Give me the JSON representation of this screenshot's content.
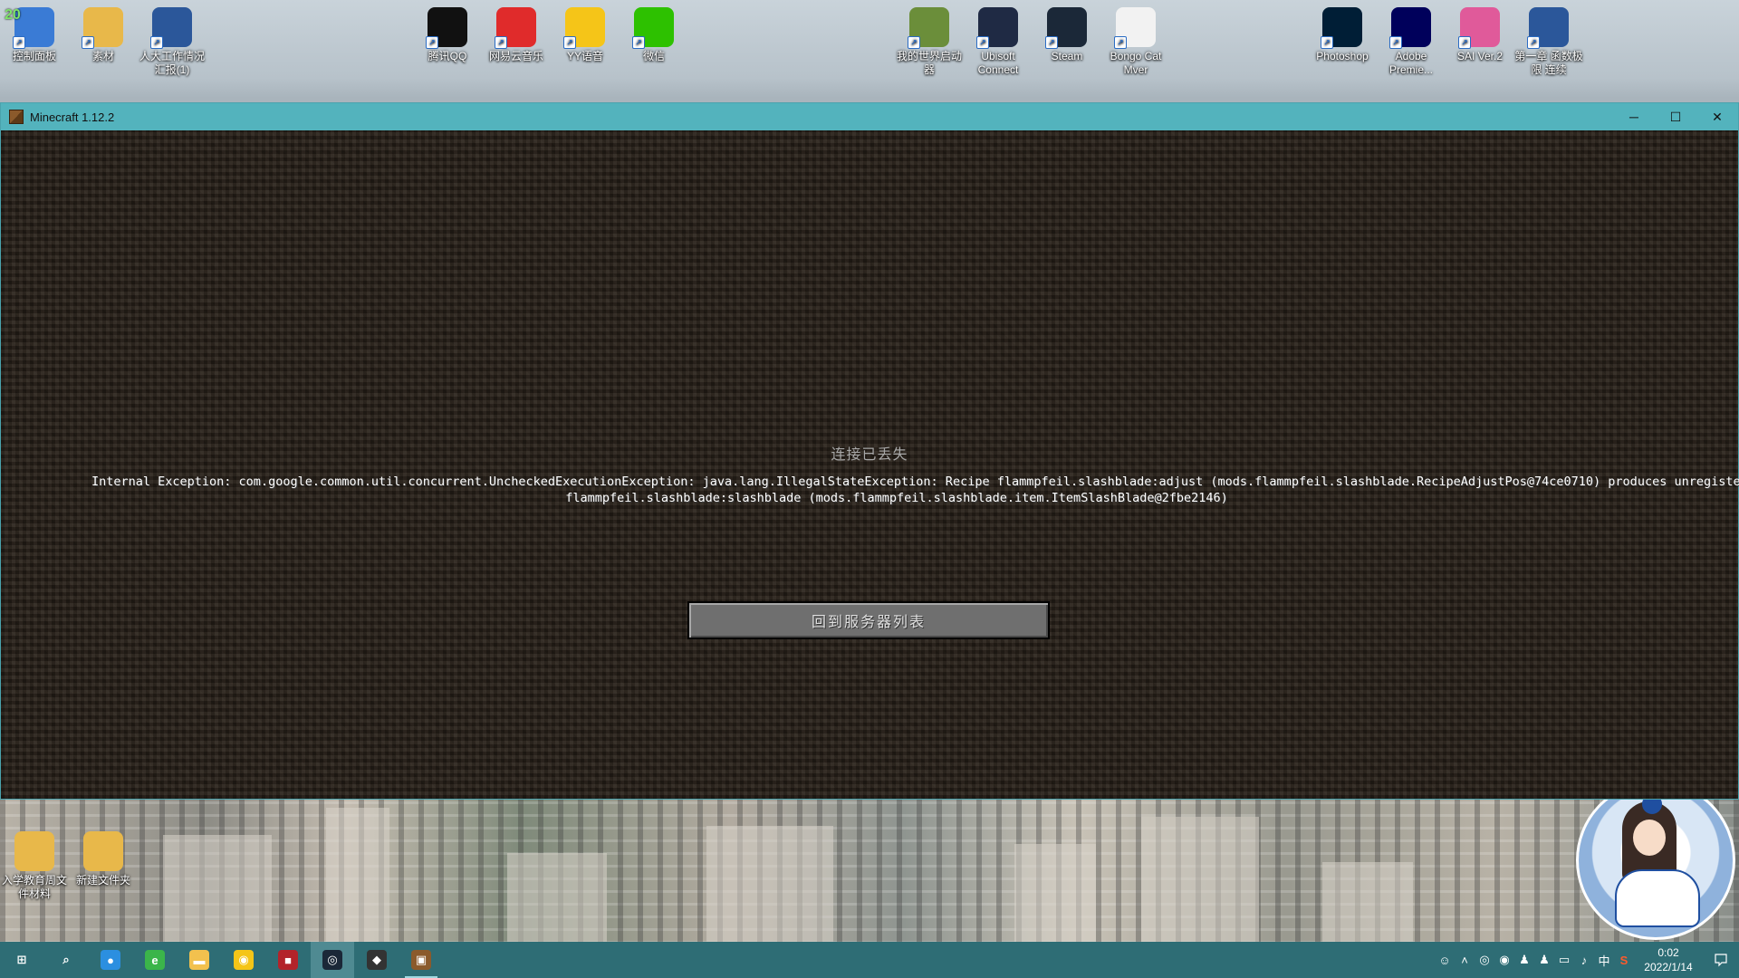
{
  "desktop": {
    "top_icons": [
      {
        "label": "控制面板",
        "icon": "control-panel-icon",
        "color": "#3a7bd5"
      },
      {
        "label": "素材",
        "icon": "folder-icon",
        "color": "#e8b84a"
      },
      {
        "label": "人大工作情况汇报(1)",
        "icon": "word-doc-icon",
        "color": "#2b579a"
      },
      {
        "label": "腾讯QQ",
        "icon": "qq-penguin-icon",
        "color": "#111111"
      },
      {
        "label": "网易云音乐",
        "icon": "netease-music-icon",
        "color": "#e02b2b"
      },
      {
        "label": "YY语音",
        "icon": "yy-voice-icon",
        "color": "#f5c518"
      },
      {
        "label": "微信",
        "icon": "wechat-icon",
        "color": "#2dc100"
      },
      {
        "label": "我的世界启动器",
        "icon": "minecraft-launcher-icon",
        "color": "#6b8e3a"
      },
      {
        "label": "Ubisoft Connect",
        "icon": "ubisoft-icon",
        "color": "#1f2a44"
      },
      {
        "label": "Steam",
        "icon": "steam-icon",
        "color": "#1b2838"
      },
      {
        "label": "Bongo Cat Mver",
        "icon": "bongo-cat-icon",
        "color": "#f2f2f2"
      },
      {
        "label": "Photoshop",
        "icon": "photoshop-icon",
        "color": "#001e36"
      },
      {
        "label": "Adobe Premie...",
        "icon": "premiere-icon",
        "color": "#00005b"
      },
      {
        "label": "SAI Ver.2",
        "icon": "sai-icon",
        "color": "#e05a9a"
      },
      {
        "label": "第一章 函数极限 连续",
        "icon": "word-doc-icon",
        "color": "#2b579a"
      }
    ],
    "bottom_icons": [
      {
        "label": "入学教育周文件材料",
        "icon": "folder-icon",
        "color": "#e8b84a"
      },
      {
        "label": "新建文件夹",
        "icon": "folder-icon",
        "color": "#e8b84a"
      }
    ],
    "badge_number": "20"
  },
  "window": {
    "title": "Minecraft 1.12.2",
    "minimize": "─",
    "maximize": "☐",
    "close": "✕"
  },
  "disconnect": {
    "title": "连接已丢失",
    "message_line1": "Internal Exception: com.google.common.util.concurrent.UncheckedExecutionException: java.lang.IllegalStateException: Recipe flammpfeil.slashblade:adjust (mods.flammpfeil.slashblade.RecipeAdjustPos@74ce0710) produces unregistered item",
    "message_line2": "flammpfeil.slashblade:slashblade (mods.flammpfeil.slashblade.item.ItemSlashBlade@2fbe2146)",
    "button": "回到服务器列表"
  },
  "taskbar": {
    "apps": [
      {
        "name": "start-button",
        "glyph": "⊞",
        "color": "#ffffff"
      },
      {
        "name": "search-icon",
        "glyph": "⌕",
        "color": "#ffffff"
      },
      {
        "name": "baidu-netdisk-icon",
        "glyph": "●",
        "color": "#2b8fe0"
      },
      {
        "name": "edge-browser-icon",
        "glyph": "e",
        "color": "#3bb54a"
      },
      {
        "name": "file-explorer-icon",
        "glyph": "▬",
        "color": "#f2c14e"
      },
      {
        "name": "yy-voice-icon",
        "glyph": "◉",
        "color": "#f5c518"
      },
      {
        "name": "red-app-icon",
        "glyph": "■",
        "color": "#b3232a"
      },
      {
        "name": "steam-icon",
        "glyph": "◎",
        "color": "#1b2838"
      },
      {
        "name": "game-controller-icon",
        "glyph": "◆",
        "color": "#333333"
      },
      {
        "name": "minecraft-icon",
        "glyph": "▣",
        "color": "#8b5a2b"
      }
    ],
    "tray": {
      "ime": "中",
      "time": "0:02",
      "date": "2022/1/14"
    }
  }
}
